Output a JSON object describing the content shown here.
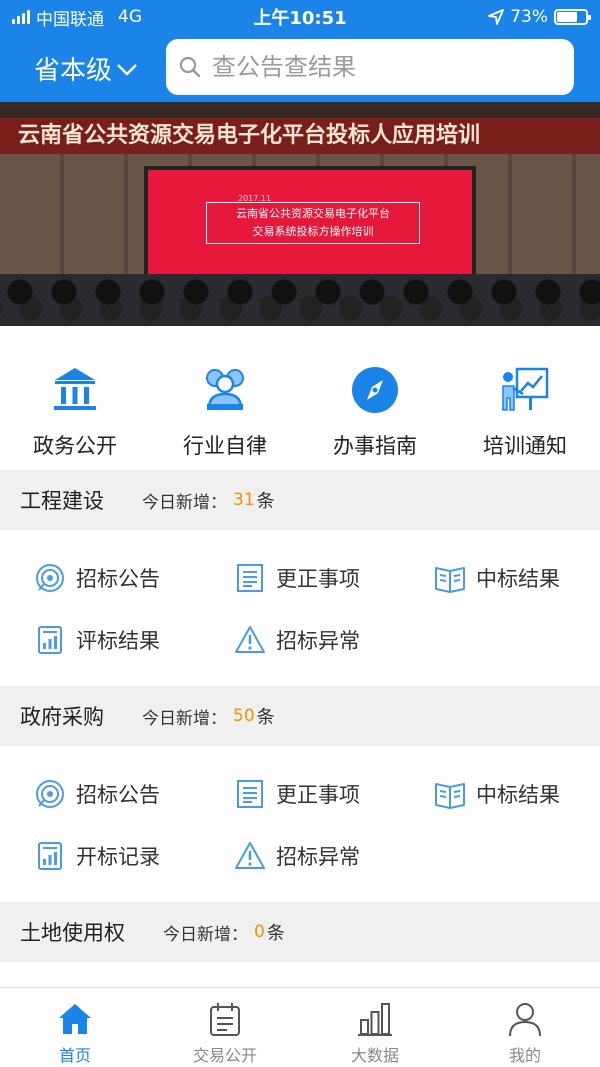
{
  "status": {
    "carrier": "中国联通",
    "network": "4G",
    "time": "上午10:51",
    "battery": "73%",
    "battery_level": 0.73
  },
  "header": {
    "region": "省本级",
    "search_placeholder": "查公告查结果"
  },
  "banner": {
    "headline": "云南省公共资源交易电子化平台投标人应用培训",
    "screen_year": "2017.11",
    "screen_line1": "云南省公共资源交易电子化平台",
    "screen_line2": "交易系统投标方操作培训"
  },
  "quick_links": [
    {
      "label": "政务公开",
      "icon": "bank-icon"
    },
    {
      "label": "行业自律",
      "icon": "group-icon"
    },
    {
      "label": "办事指南",
      "icon": "compass-icon"
    },
    {
      "label": "培训通知",
      "icon": "presentation-icon"
    }
  ],
  "sections": [
    {
      "title": "工程建设",
      "today_label": "今日新增：",
      "count": "31",
      "unit": "条",
      "items": [
        {
          "label": "招标公告",
          "icon": "target-icon"
        },
        {
          "label": "更正事项",
          "icon": "document-icon"
        },
        {
          "label": "中标结果",
          "icon": "book-icon"
        },
        {
          "label": "评标结果",
          "icon": "report-chart-icon"
        },
        {
          "label": "招标异常",
          "icon": "warning-icon"
        }
      ]
    },
    {
      "title": "政府采购",
      "today_label": "今日新增：",
      "count": "50",
      "unit": "条",
      "items": [
        {
          "label": "招标公告",
          "icon": "target-icon"
        },
        {
          "label": "更正事项",
          "icon": "document-icon"
        },
        {
          "label": "中标结果",
          "icon": "book-icon"
        },
        {
          "label": "开标记录",
          "icon": "report-chart-icon"
        },
        {
          "label": "招标异常",
          "icon": "warning-icon"
        }
      ]
    },
    {
      "title": "土地使用权",
      "today_label": "今日新增：",
      "count": "0",
      "unit": "条"
    }
  ],
  "tabs": [
    {
      "label": "首页",
      "icon": "home-icon",
      "active": true
    },
    {
      "label": "交易公开",
      "icon": "clipboard-icon",
      "active": false
    },
    {
      "label": "大数据",
      "icon": "bar-chart-icon",
      "active": false
    },
    {
      "label": "我的",
      "icon": "user-icon",
      "active": false
    }
  ],
  "colors": {
    "primary": "#1a84e8",
    "accent_count": "#f29100"
  }
}
